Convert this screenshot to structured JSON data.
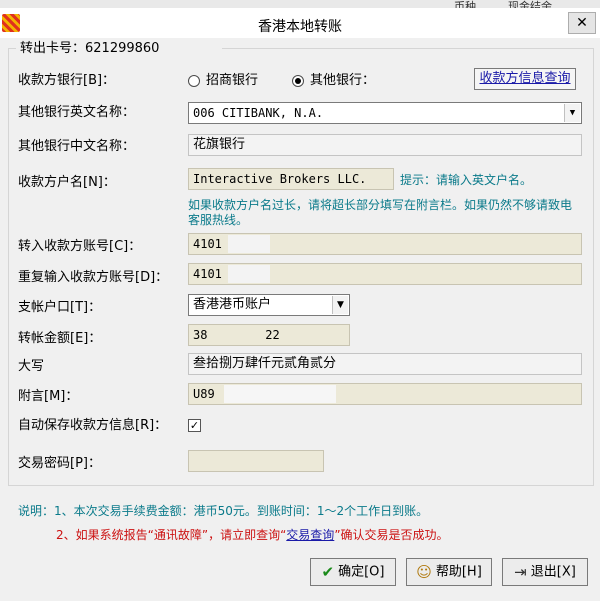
{
  "background": {
    "col1": "币种",
    "col2": "现金结余"
  },
  "window": {
    "title": "香港本地转账",
    "close_glyph": "✕"
  },
  "form": {
    "from_card_label": "转出卡号：",
    "from_card_value": "621299860",
    "payee_bank": {
      "label": "收款方银行[B]：",
      "option_cmb": "招商银行",
      "option_other": "其他银行：",
      "selected": "其他银行",
      "info_query_button": "收款方信息查询"
    },
    "other_bank_en": {
      "label": "其他银行英文名称：",
      "value": "006 CITIBANK, N.A."
    },
    "other_bank_cn": {
      "label": "其他银行中文名称：",
      "value": "花旗银行"
    },
    "payee_name": {
      "label": "收款方户名[N]：",
      "value": "Interactive Brokers LLC.",
      "tip": "提示：请输入英文户名。",
      "hint": "如果收款方户名过长，请将超长部分填写在附言栏。如果仍然不够请致电客服热线。"
    },
    "payee_account": {
      "label": "转入收款方账号[C]：",
      "value": "4101"
    },
    "payee_account_repeat": {
      "label": "重复输入收款方账号[D]：",
      "value": "4101"
    },
    "sub_account": {
      "label": "支帐户口[T]：",
      "value": "香港港币账户"
    },
    "amount": {
      "label": "转帐金额[E]：",
      "value": "38        22"
    },
    "amount_upper": {
      "label": "大写",
      "value": "叁拾捌万肆仟元贰角贰分"
    },
    "memo": {
      "label": "附言[M]：",
      "value": "U89"
    },
    "auto_save": {
      "label": "自动保存收款方信息[R]：",
      "checked": true,
      "check_glyph": "✓"
    },
    "trade_password": {
      "label": "交易密码[P]：",
      "value": ""
    }
  },
  "notes": {
    "line1": "说明：1、本次交易手续费金额：港币50元。到账时间：1～2个工作日到账。",
    "line2_before": "2、如果系统报告“通讯故障”，请立即查询“",
    "line2_link": "交易查询",
    "line2_after": "”确认交易是否成功。"
  },
  "buttons": {
    "confirm": "确定[O]",
    "help": "帮助[H]",
    "exit": "退出[X]"
  },
  "colors": {
    "field_bg": "#ece9d8",
    "hint_teal": "#0a7a8a",
    "warning_red": "#cc1111",
    "link_blue": "#1a1aa8"
  }
}
